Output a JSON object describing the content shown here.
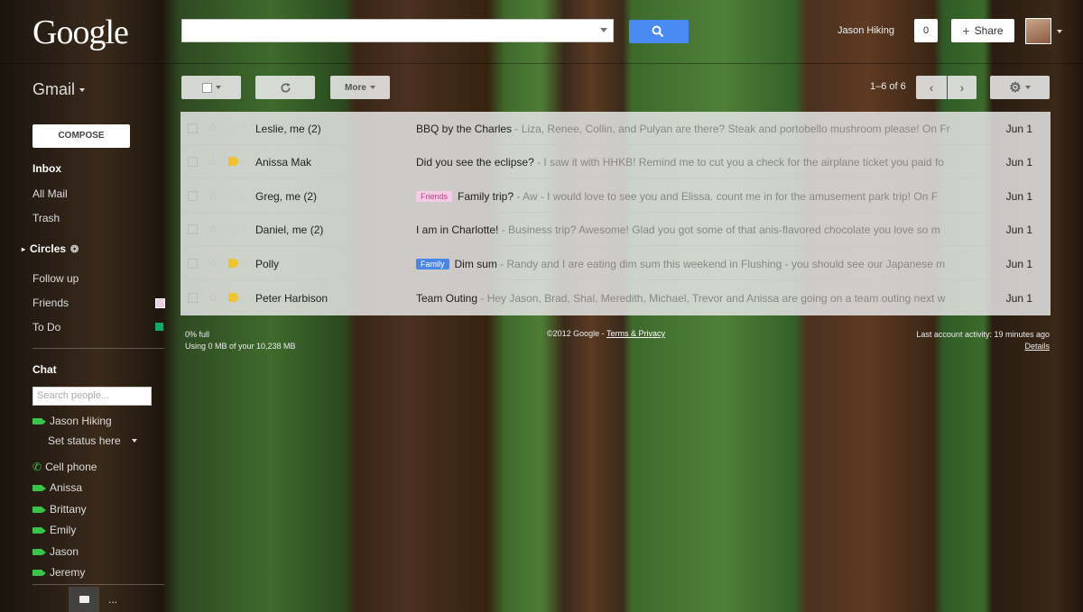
{
  "header": {
    "logo": "Google",
    "user_name": "Jason Hiking",
    "notifications_count": "0",
    "share_label": "Share"
  },
  "sidebar": {
    "app_label": "Gmail",
    "compose_label": "COMPOSE",
    "nav": [
      {
        "label": "Inbox"
      },
      {
        "label": "All Mail"
      },
      {
        "label": "Trash"
      },
      {
        "label": "Circles"
      },
      {
        "label": "Follow up"
      },
      {
        "label": "Friends"
      },
      {
        "label": "To Do"
      }
    ],
    "label_colors": {
      "friends": "#f4cce6",
      "todo": "#16a765"
    }
  },
  "chat": {
    "title": "Chat",
    "search_placeholder": "Search people...",
    "me": "Jason Hiking",
    "status_text": "Set status here",
    "contacts": [
      "Cell phone",
      "Anissa",
      "Brittany",
      "Emily",
      "Jason",
      "Jeremy"
    ],
    "more_label": "..."
  },
  "toolbar": {
    "more_label": "More",
    "page_info": "1–6 of 6"
  },
  "emails": [
    {
      "sender": "Leslie, me (2)",
      "label": "",
      "subject": "BBQ by the Charles",
      "snippet": " - Liza, Renee, Collin, and Pulyan are there? Steak and portobello mushroom please! On Fr",
      "date": "Jun 1",
      "important": false
    },
    {
      "sender": "Anissa Mak",
      "label": "",
      "subject": "Did you see the eclipse?",
      "snippet": " - I saw it with HHKB! Remind me to cut you a check for the airplane ticket you paid fo",
      "date": "Jun 1",
      "important": true
    },
    {
      "sender": "Greg, me (2)",
      "label": "Friends",
      "subject": "Family trip?",
      "snippet": " - Aw - I would love to see you and Elissa. count me in for the amusement park trip! On F",
      "date": "Jun 1",
      "important": false
    },
    {
      "sender": "Daniel, me (2)",
      "label": "",
      "subject": "I am in Charlotte!",
      "snippet": " - Business trip? Awesome! Glad you got some of that anis-flavored chocolate you love so m",
      "date": "Jun 1",
      "important": false
    },
    {
      "sender": "Polly",
      "label": "Family",
      "subject": "Dim sum",
      "snippet": " - Randy and I are eating dim sum this weekend in Flushing - you should see our Japanese m",
      "date": "Jun 1",
      "important": true
    },
    {
      "sender": "Peter Harbison",
      "label": "",
      "subject": "Team Outing",
      "snippet": " - Hey Jason, Brad, Shal, Meredith, Michael, Trevor and Anissa are going on a team outing next w",
      "date": "Jun 1",
      "important": true
    }
  ],
  "footer": {
    "storage_line1": "0% full",
    "storage_line2": "Using 0 MB of your 10,238 MB",
    "copyright": "©2012 Google - ",
    "terms": "Terms & Privacy",
    "activity": "Last account activity: 19 minutes ago",
    "details": "Details"
  }
}
